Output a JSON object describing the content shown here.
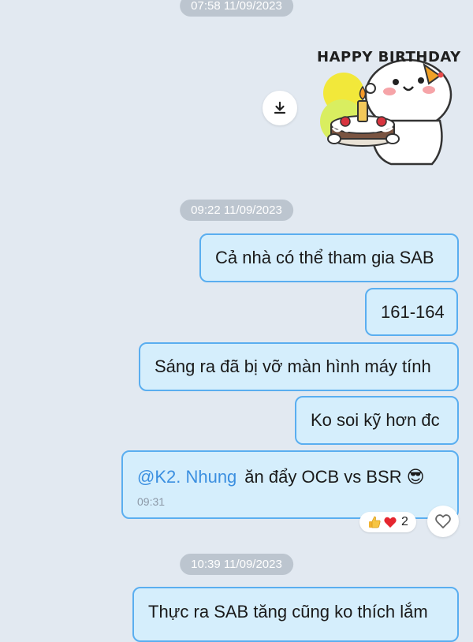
{
  "timestamps": [
    "07:58 11/09/2023",
    "09:22 11/09/2023",
    "10:39 11/09/2023"
  ],
  "sticker": {
    "title": "HAPPY BIRTHDAY",
    "icon": "birthday-cake-sticker"
  },
  "messages": [
    {
      "text": "Cả nhà có thể tham gia SAB"
    },
    {
      "text": "161-164"
    },
    {
      "text": "Sáng ra đã bị vỡ màn hình máy tính"
    },
    {
      "text": "Ko soi kỹ hơn đc"
    },
    {
      "mention": "@K2. Nhung",
      "text": "ăn đẩy OCB vs BSR",
      "emoji": "😎",
      "time": "09:31"
    },
    {
      "text": "Thực ra SAB tăng cũng ko thích lắm"
    }
  ],
  "reactions": {
    "count": "2",
    "icons": [
      "thumbs-up-icon",
      "heart-icon"
    ]
  },
  "colors": {
    "background": "#e2e9f1",
    "bubble_fill": "#d5eefc",
    "bubble_border": "#5aaef0",
    "mention": "#3b8fe0",
    "timestamp_pill": "#bcc5cf"
  }
}
